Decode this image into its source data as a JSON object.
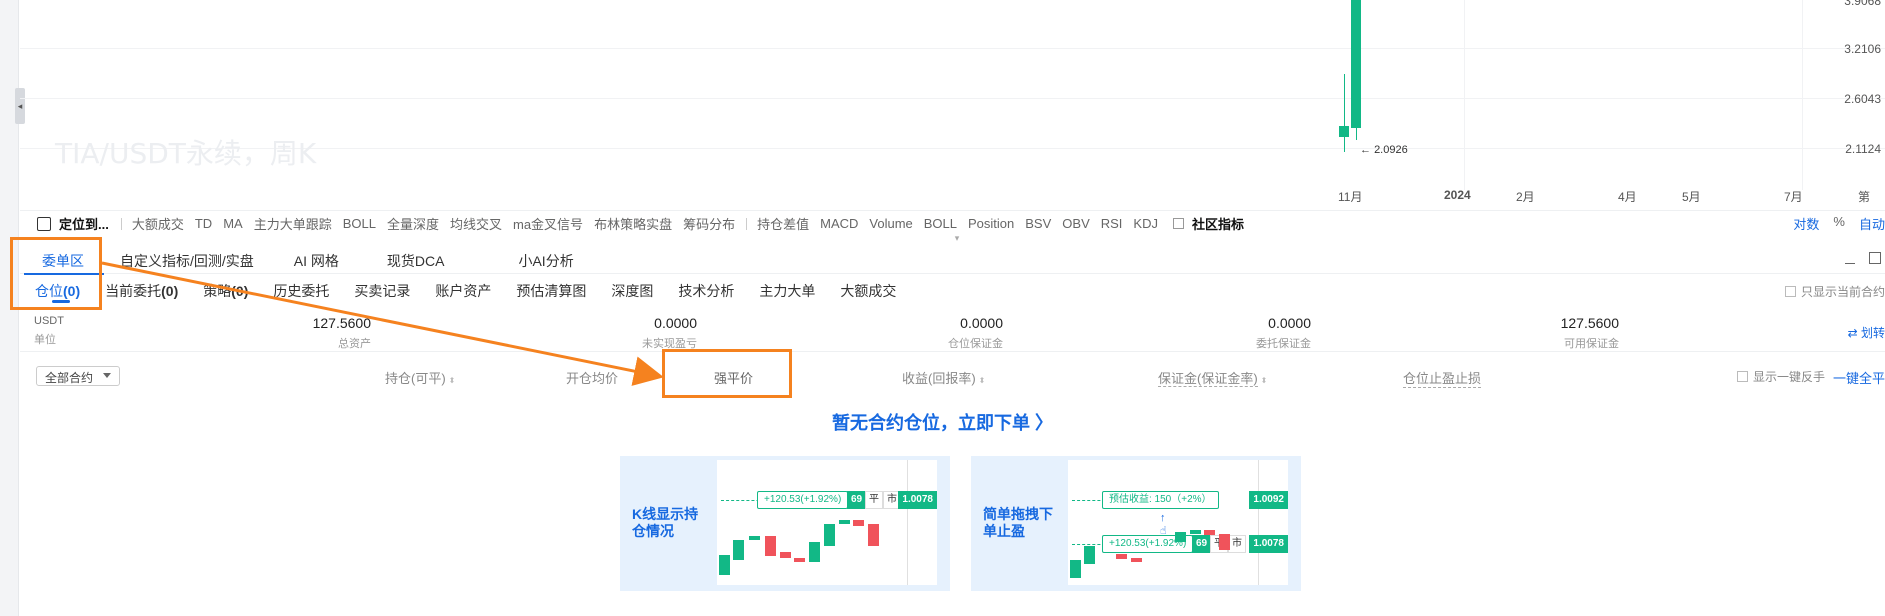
{
  "chart": {
    "watermark": "TIA/USDT永续，周K",
    "y_labels": [
      "3.9068",
      "3.2106",
      "2.6043",
      "2.1124"
    ],
    "x_labels": [
      "11月",
      "2024",
      "2月",
      "4月",
      "5月",
      "7月",
      "第"
    ],
    "last_low_label": "2.0926"
  },
  "indicator_bar": {
    "locate": "定位到...",
    "items_left": [
      "大额成交",
      "TD",
      "MA",
      "主力大单跟踪",
      "BOLL",
      "全量深度",
      "均线交叉",
      "ma金叉信号",
      "布林策略实盘",
      "筹码分布"
    ],
    "items_right": [
      "持仓差值",
      "MACD",
      "Volume",
      "BOLL",
      "Position",
      "BSV",
      "OBV",
      "RSI",
      "KDJ"
    ],
    "community": "社区指标",
    "log": "对数",
    "pct": "%",
    "auto": "自动"
  },
  "tabs_top": [
    "委单区",
    "自定义指标/回测/实盘",
    "AI 网格",
    "现货DCA",
    "小AI分析"
  ],
  "tabs_sub": {
    "positions": "仓位",
    "positions_count": "(0)",
    "current_orders": "当前委托",
    "current_orders_count": "(0)",
    "strategy": "策略",
    "strategy_count": "(0)",
    "others": [
      "历史委托",
      "买卖记录",
      "账户资产",
      "预估清算图",
      "深度图",
      "技术分析",
      "主力大单",
      "大额成交"
    ],
    "only_current": "只显示当前合约"
  },
  "stats": {
    "unit_value": "USDT",
    "unit_label": "单位",
    "total_assets": "127.5600",
    "total_assets_label": "总资产",
    "unrealized": "0.0000",
    "unrealized_label": "未实现盈亏",
    "position_margin": "0.0000",
    "position_margin_label": "仓位保证金",
    "order_margin": "0.0000",
    "order_margin_label": "委托保证金",
    "available": "127.5600",
    "available_label": "可用保证金",
    "transfer": "⇄ 划转"
  },
  "columns": {
    "all_contracts": "全部合约",
    "position": "持仓(可平)",
    "entry_price": "开仓均价",
    "liq_price": "强平价",
    "pnl": "收益(回报率)",
    "margin": "保证金(保证金率)",
    "tp_sl": "仓位止盈止损",
    "show_reverse": "显示一键反手",
    "close_all": "一键全平"
  },
  "empty_state": {
    "text": "暂无合约仓位，立即下单 〉",
    "card1_title": "K线显示持仓情况",
    "card1_pnl": "+120.53(+1.92%)",
    "card1_qty": "69",
    "card1_close": "平",
    "card1_market": "市",
    "card1_price": "1.0078",
    "card2_title": "简单拖拽下单止盈",
    "card2_est": "预估收益: 150（+2%）",
    "card2_tp_price": "1.0092",
    "card2_pnl": "+120.53(+1.92%)",
    "card2_qty": "69",
    "card2_close": "平",
    "card2_market": "市",
    "card2_price": "1.0078"
  },
  "colors": {
    "accent": "#1769e0",
    "up": "#12b886",
    "down": "#f0535b",
    "annotation": "#f5821f"
  }
}
